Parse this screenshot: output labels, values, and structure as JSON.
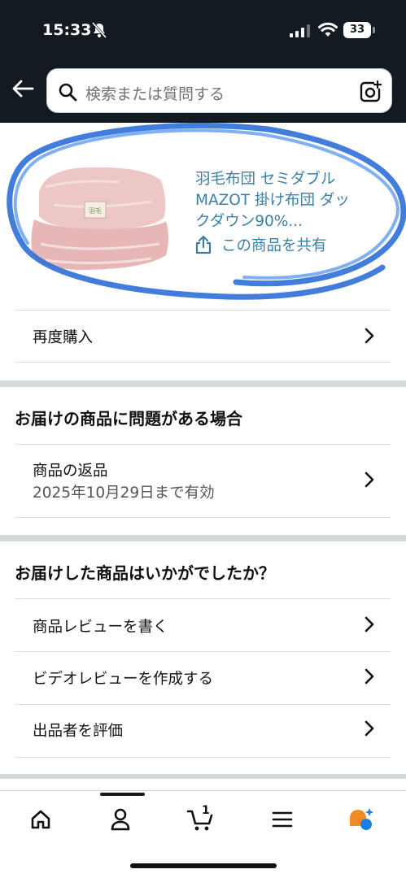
{
  "status_bar": {
    "time": "15:33",
    "battery": "33"
  },
  "search": {
    "placeholder": "検索または質問する"
  },
  "product": {
    "title_line1": "羽毛布団 セミダブル",
    "title_line2": "MAZOT 掛け布団 ダッ",
    "title_line3": "クダウン90%...",
    "share_label": "この商品を共有"
  },
  "rebuy": {
    "label": "再度購入"
  },
  "problem_section": {
    "title": "お届けの商品に問題がある場合",
    "return_label": "商品の返品",
    "return_deadline": "2025年10月29日まで有効"
  },
  "feedback_section": {
    "title": "お届けした商品はいかがでしたか？",
    "items": [
      {
        "label": "商品レビューを書く"
      },
      {
        "label": "ビデオレビューを作成する"
      },
      {
        "label": "出品者を評価"
      }
    ]
  },
  "bottom_nav": {
    "items": [
      "home-icon",
      "account-icon",
      "cart-icon",
      "menu-icon",
      "rufus-icon"
    ],
    "cart_count": "1"
  },
  "colors": {
    "header_bg": "#131a22",
    "link": "#3a7fa8",
    "scribble": "#2f6fd8",
    "assistant_orange": "#f08a24",
    "assistant_blue": "#1a7fe0"
  }
}
